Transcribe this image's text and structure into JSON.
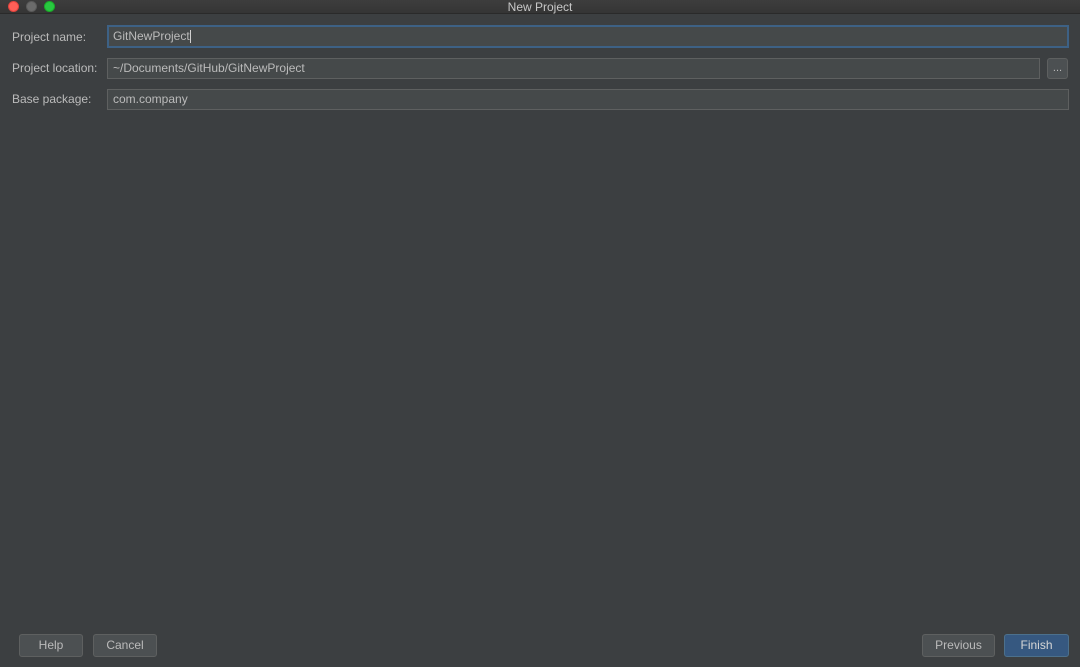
{
  "window": {
    "title": "New Project"
  },
  "form": {
    "project_name": {
      "label": "Project name:",
      "value": "GitNewProject"
    },
    "project_location": {
      "label": "Project location:",
      "value": "~/Documents/GitHub/GitNewProject",
      "browse_label": "..."
    },
    "base_package": {
      "label": "Base package:",
      "value": "com.company"
    }
  },
  "footer": {
    "help": "Help",
    "cancel": "Cancel",
    "previous": "Previous",
    "finish": "Finish"
  },
  "colors": {
    "background": "#3c3f41",
    "field_background": "#45494a",
    "focus_border": "#3d6185",
    "primary_button": "#365880"
  }
}
